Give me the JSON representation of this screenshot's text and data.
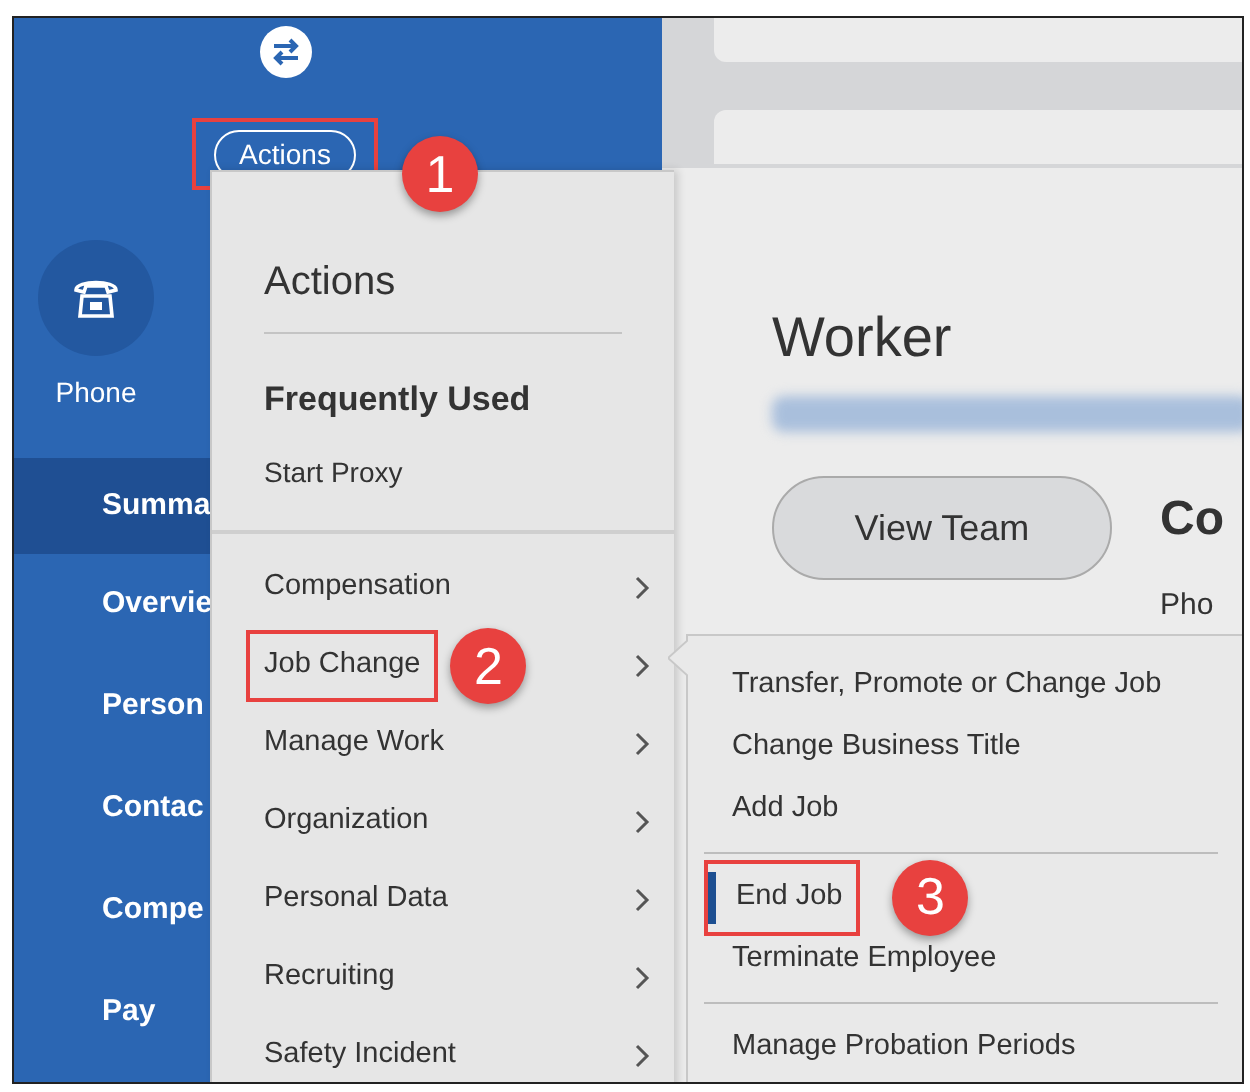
{
  "sidebar": {
    "actions_button": {
      "label": "Actions",
      "callout": "1"
    },
    "phone": {
      "label": "Phone"
    },
    "nav": [
      {
        "label": "Summa",
        "selected": true
      },
      {
        "label": "Overvie",
        "selected": false
      },
      {
        "label": "Person",
        "selected": false
      },
      {
        "label": "Contac",
        "selected": false
      },
      {
        "label": "Compe",
        "selected": false
      },
      {
        "label": "Pay",
        "selected": false
      }
    ]
  },
  "main": {
    "title": "Worker",
    "button": "View Team",
    "heading": "Co",
    "field_label": "Pho"
  },
  "actions_menu": {
    "title": "Actions",
    "section": "Frequently Used",
    "frequent": [
      "Start Proxy"
    ],
    "categories": [
      {
        "label": "Compensation"
      },
      {
        "label": "Job Change",
        "callout": "2"
      },
      {
        "label": "Manage Work"
      },
      {
        "label": "Organization"
      },
      {
        "label": "Personal Data"
      },
      {
        "label": "Recruiting"
      },
      {
        "label": "Safety Incident"
      }
    ]
  },
  "submenu": {
    "groups": [
      [
        {
          "label": "Transfer, Promote or Change Job",
          "selected": false
        },
        {
          "label": "Change Business Title",
          "selected": false
        },
        {
          "label": "Add Job",
          "selected": false
        }
      ],
      [
        {
          "label": "End Job",
          "selected": true,
          "callout": "3"
        },
        {
          "label": "Terminate Employee",
          "selected": false
        }
      ],
      [
        {
          "label": "Manage Probation Periods",
          "selected": false
        }
      ]
    ]
  }
}
